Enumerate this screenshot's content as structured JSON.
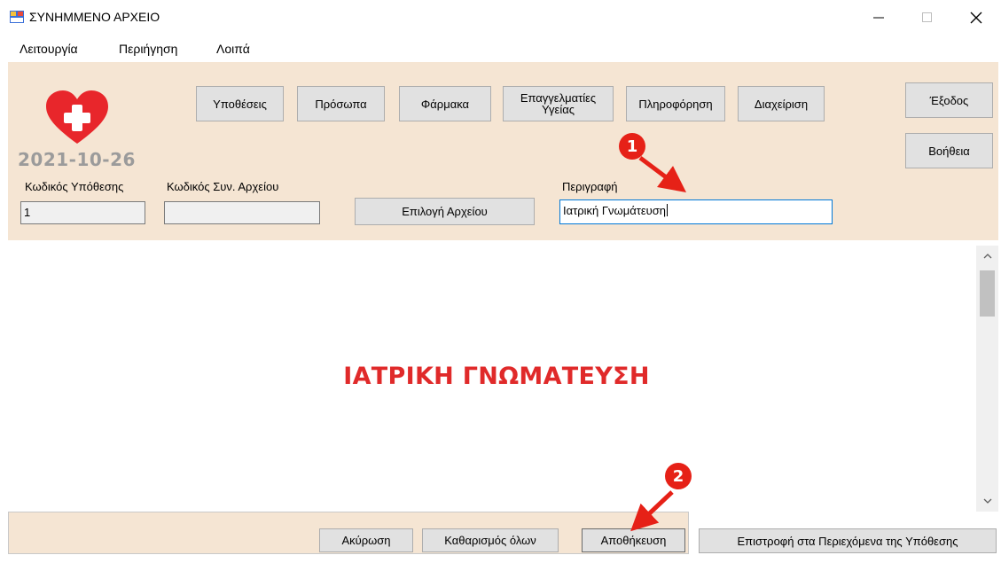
{
  "window": {
    "title": "ΣΥΝΗΜΜΕΝΟ ΑΡΧΕΙΟ"
  },
  "menu": [
    "Λειτουργία",
    "Περιήγηση",
    "Λοιπά"
  ],
  "nav": {
    "cases": "Υποθέσεις",
    "persons": "Πρόσωπα",
    "drugs": "Φάρμακα",
    "health_pros_line1": "Επαγγελματίες",
    "health_pros_line2": "Υγείας",
    "information": "Πληροφόρηση",
    "management": "Διαχείριση",
    "exit": "Έξοδος",
    "help": "Βοήθεια"
  },
  "date": "2021-10-26",
  "form": {
    "case_code_label": "Κωδικός Υπόθεσης",
    "case_code_value": "1",
    "attach_code_label": "Κωδικός Συν. Αρχείου",
    "attach_code_value": "",
    "choose_file": "Επιλογή Αρχείου",
    "description_label": "Περιγραφή",
    "description_value": "Ιατρική Γνωμάτευση"
  },
  "document": {
    "text": "ΙΑΤΡΙΚΗ ΓΝΩΜΑΤΕΥΣΗ"
  },
  "actions": {
    "cancel": "Ακύρωση",
    "clear_all": "Καθαρισμός όλων",
    "save": "Αποθήκευση",
    "return": "Επιστροφή στα Περιεχόμενα της Υπόθεσης"
  },
  "annotations": {
    "step1": "1",
    "step2": "2"
  },
  "colors": {
    "panel": "#f5e5d3",
    "heart": "#e8262b",
    "marker": "#e62117",
    "doc_text": "#e02a2a"
  }
}
